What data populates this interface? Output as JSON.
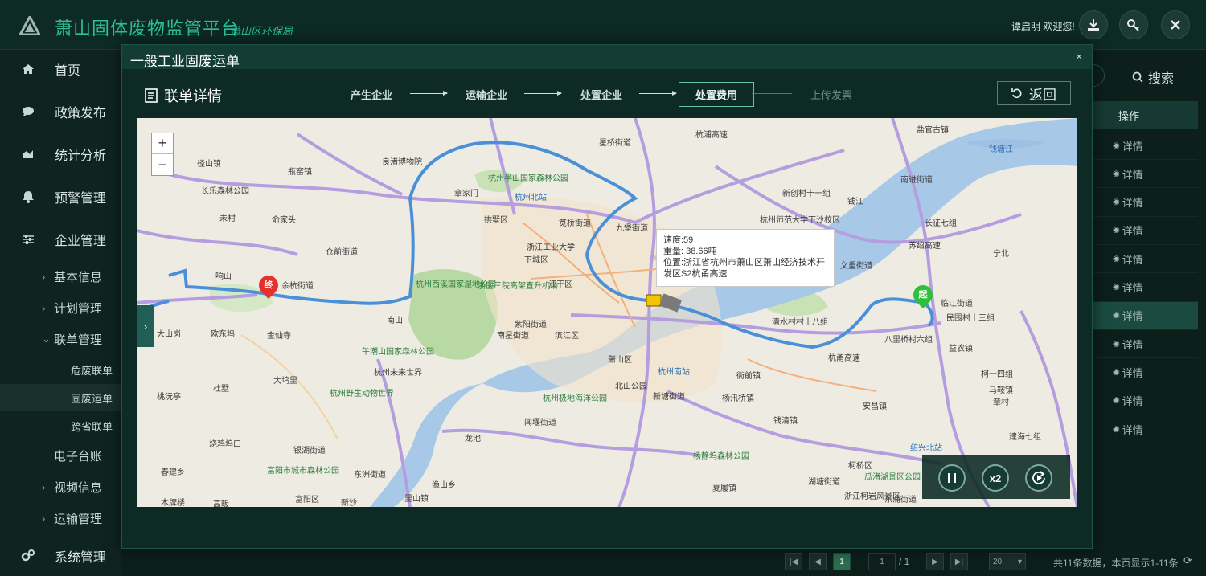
{
  "app": {
    "title": "萧山固体废物监管平台",
    "subtitle": "萧山区环保局",
    "user_greeting": "谭启明 欢迎您!"
  },
  "sidebar": {
    "items": [
      {
        "label": "首页",
        "icon": "home-icon"
      },
      {
        "label": "政策发布",
        "icon": "chat-icon"
      },
      {
        "label": "统计分析",
        "icon": "chart-icon"
      },
      {
        "label": "预警管理",
        "icon": "bell-icon"
      },
      {
        "label": "企业管理",
        "icon": "sliders-icon"
      }
    ],
    "sub_items": [
      {
        "label": "基本信息"
      },
      {
        "label": "计划管理"
      },
      {
        "label": "联单管理"
      }
    ],
    "sub_sub_items": [
      {
        "label": "危废联单"
      },
      {
        "label": "固废运单"
      },
      {
        "label": "跨省联单"
      }
    ],
    "more_items": [
      {
        "label": "电子台账"
      },
      {
        "label": "视频信息"
      },
      {
        "label": "运输管理"
      }
    ],
    "system": {
      "label": "系统管理",
      "icon": "gears-icon"
    }
  },
  "background": {
    "search_label": "搜索",
    "op_header": "操作",
    "row_action": "详情",
    "row_count": 11,
    "highlight_row": 7,
    "pager": {
      "current": "1",
      "input": "1",
      "total": "/ 1",
      "page_size": "20",
      "summary": "共11条数据，本页显示1-11条"
    }
  },
  "modal": {
    "title": "一般工业固废运单",
    "close": "×",
    "detail_title": "联单详情",
    "steps": [
      "产生企业",
      "运输企业",
      "处置企业",
      "处置费用",
      "上传发票"
    ],
    "active_step": 3,
    "back_label": "返回"
  },
  "map": {
    "zoom_in": "+",
    "zoom_out": "−",
    "tooltip": {
      "speed": "速度:59",
      "weight": "重量:  38.66吨",
      "location": "位置:浙江省杭州市萧山区萧山经济技术开发区S2杭甬高速"
    },
    "start_marker": "起",
    "end_marker": "终",
    "controls": {
      "speed": "x2"
    },
    "labels": [
      {
        "t": "盐官古镇"
      },
      {
        "t": "钱塘江"
      },
      {
        "t": "星桥街道"
      },
      {
        "t": "杭浦高速"
      },
      {
        "t": "良渚博物院"
      },
      {
        "t": "瓶窑镇"
      },
      {
        "t": "径山镇"
      },
      {
        "t": "长乐森林公园"
      },
      {
        "t": "杭州半山国家森林公园"
      },
      {
        "t": "杭州北站"
      },
      {
        "t": "章家门"
      },
      {
        "t": "南进街道"
      },
      {
        "t": "新创村十一组"
      },
      {
        "t": "钱江"
      },
      {
        "t": "长征七组"
      },
      {
        "t": "杭州师范大学下沙校区"
      },
      {
        "t": "未村"
      },
      {
        "t": "俞家头"
      },
      {
        "t": "拱墅区"
      },
      {
        "t": "笕桥街道"
      },
      {
        "t": "九堡街道"
      },
      {
        "t": "浙江工业大学"
      },
      {
        "t": "下城区"
      },
      {
        "t": "仓前街道"
      },
      {
        "t": "宁北"
      },
      {
        "t": "文重街道"
      },
      {
        "t": "苏绍高速"
      },
      {
        "t": "杭州西溪国家湿地公园"
      },
      {
        "t": "浙医三院高架直升机场"
      },
      {
        "t": "江干区"
      },
      {
        "t": "响山"
      },
      {
        "t": "余杭街道"
      },
      {
        "t": "临江街道"
      },
      {
        "t": "民围村十三组"
      },
      {
        "t": "南山"
      },
      {
        "t": "紫阳街道"
      },
      {
        "t": "滨江区"
      },
      {
        "t": "清水村村十八组"
      },
      {
        "t": "八里桥村六组"
      },
      {
        "t": "益农镇"
      },
      {
        "t": "大山岗"
      },
      {
        "t": "欧东坞"
      },
      {
        "t": "金仙寺"
      },
      {
        "t": "南星街道"
      },
      {
        "t": "杭甬高速"
      },
      {
        "t": "午潮山国家森林公园"
      },
      {
        "t": "杭州未来世界"
      },
      {
        "t": "萧山区"
      },
      {
        "t": "杭州南站"
      },
      {
        "t": "衙前镇"
      },
      {
        "t": "柯一四组"
      },
      {
        "t": "大坞里"
      },
      {
        "t": "杜墅"
      },
      {
        "t": "杭州野生动物世界"
      },
      {
        "t": "北山公园"
      },
      {
        "t": "新塘街道"
      },
      {
        "t": "杨汛桥镇"
      },
      {
        "t": "马鞍镇"
      },
      {
        "t": "桃沅亭"
      },
      {
        "t": "杭州极地海洋公园"
      },
      {
        "t": "安昌镇"
      },
      {
        "t": "章村"
      },
      {
        "t": "闻堰街道"
      },
      {
        "t": "钱清镇"
      },
      {
        "t": "烧鸡坞口"
      },
      {
        "t": "银湖街道"
      },
      {
        "t": "龙池"
      },
      {
        "t": "绍兴北站"
      },
      {
        "t": "建海七组"
      },
      {
        "t": "春建乡"
      },
      {
        "t": "富阳市城市森林公园"
      },
      {
        "t": "东洲街道"
      },
      {
        "t": "杨静坞森林公园"
      },
      {
        "t": "柯桥区"
      },
      {
        "t": "瓜渚湖景区公园"
      },
      {
        "t": "富阳区"
      },
      {
        "t": "渔山乡"
      },
      {
        "t": "夏履镇"
      },
      {
        "t": "湖塘街道"
      },
      {
        "t": "木牌楼"
      },
      {
        "t": "高畈"
      },
      {
        "t": "新沙"
      },
      {
        "t": "里山镇"
      },
      {
        "t": "浙江柯岩风景区"
      },
      {
        "t": "东浦街道"
      }
    ]
  }
}
